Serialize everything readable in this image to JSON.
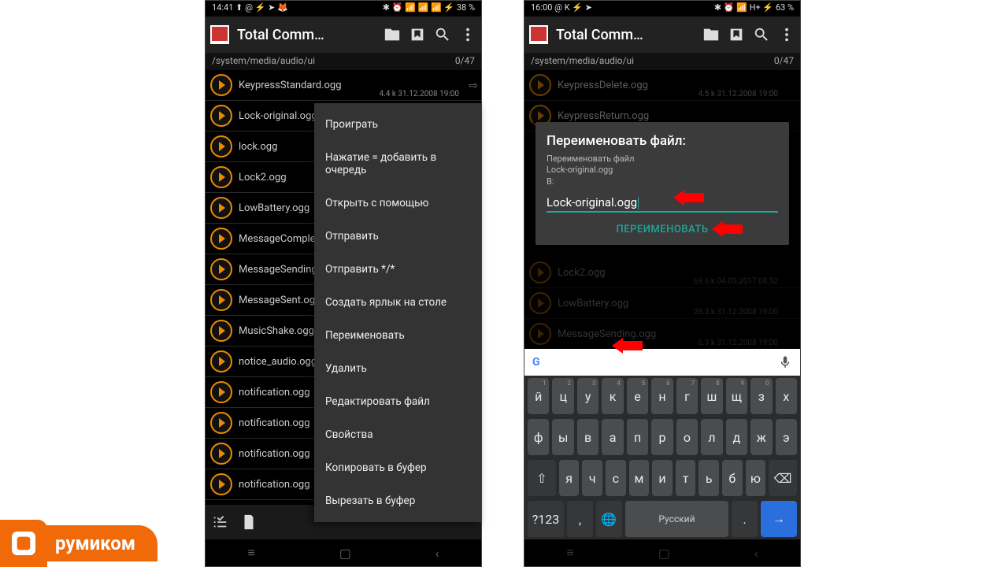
{
  "status_left": {
    "a": "14:41  ⬆ @ ⚡ ➤ 🦊",
    "b": "16:00  @ K ⚡ ➤"
  },
  "status_right": {
    "a": "✱ ⏰ 📶 📶 📶 ⚡ 38 %",
    "b": "✱ ⏰ 📶 H+ ⚡ 63 %"
  },
  "app_title": "Total Comm…",
  "path": "/system/media/audio/ui",
  "counter": "0/47",
  "files_a": [
    {
      "n": "KeypressStandard.ogg",
      "m": "4.4 k  31.12.2008  19:00",
      "arr": true
    },
    {
      "n": "Lock-original.ogg",
      "m": "",
      "arr": true
    },
    {
      "n": "lock.ogg"
    },
    {
      "n": "Lock2.ogg"
    },
    {
      "n": "LowBattery.ogg"
    },
    {
      "n": "MessageComplete.ogg"
    },
    {
      "n": "MessageSending.ogg"
    },
    {
      "n": "MessageSent.ogg"
    },
    {
      "n": "MusicShake.ogg"
    },
    {
      "n": "notice_audio.ogg"
    },
    {
      "n": "notification.ogg"
    },
    {
      "n": "notification.ogg"
    },
    {
      "n": "notification.ogg"
    },
    {
      "n": "notification.ogg"
    }
  ],
  "ctx_items": [
    "Проиграть",
    "Нажатие = добавить в очередь",
    "Открыть с помощью",
    "Отправить",
    "Отправить */*",
    "Создать ярлык на столе",
    "Переименовать",
    "Удалить",
    "Редактировать файл",
    "Свойства",
    "Копировать в буфер",
    "Вырезать в буфер"
  ],
  "files_b_top": [
    {
      "n": "KeypressDelete.ogg",
      "m": "4.5 k  31.12.2008  19:00"
    },
    {
      "n": "KeypressReturn.ogg",
      "m": ""
    }
  ],
  "files_b_mid": [
    {
      "n": "Lock2.ogg",
      "m": "69.6 k  04.03.2017  08:52"
    },
    {
      "n": "LowBattery.ogg",
      "m": "28.3 k  31.12.2008  19:00"
    },
    {
      "n": "MessageSending.ogg",
      "m": "6.3 k  31.12.2008  19:00"
    }
  ],
  "hidden_meta": "19:00",
  "dialog": {
    "title": "Переименовать файл:",
    "sub1": "Переименовать файл",
    "sub2": "Lock-original.ogg",
    "sub3": "В:",
    "value": "Lock-original.ogg",
    "action": "ПЕРЕИМЕНОВАТЬ"
  },
  "kbd": {
    "r1": [
      [
        "й",
        "1"
      ],
      [
        "ц",
        "2"
      ],
      [
        "у",
        "3"
      ],
      [
        "к",
        "4"
      ],
      [
        "е",
        "5"
      ],
      [
        "н",
        "6"
      ],
      [
        "г",
        "7"
      ],
      [
        "ш",
        "8"
      ],
      [
        "щ",
        "9"
      ],
      [
        "з",
        "0"
      ],
      [
        "х",
        ""
      ]
    ],
    "r2": [
      "ф",
      "ы",
      "в",
      "а",
      "п",
      "р",
      "о",
      "л",
      "д",
      "ж",
      "э"
    ],
    "r3": [
      "я",
      "ч",
      "с",
      "м",
      "и",
      "т",
      "ь",
      "б",
      "ю"
    ],
    "shift": "⇧",
    "bsp": "⌫",
    "num": "?123",
    "lang": "Русский",
    "enter": "→"
  },
  "logo": "румиком"
}
